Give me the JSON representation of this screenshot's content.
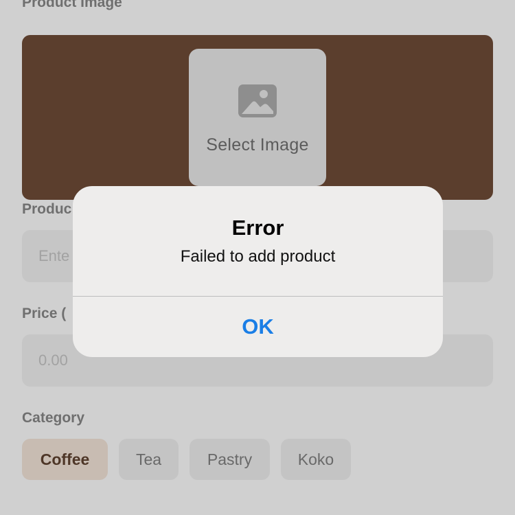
{
  "form": {
    "image_section_label": "Product Image",
    "select_image_label": "Select Image",
    "photo_icon": "photo-icon",
    "name_label": "Produc",
    "name_placeholder": "Ente",
    "price_label": "Price (",
    "price_placeholder": "0.00",
    "category_label": "Category",
    "categories": [
      {
        "label": "Coffee",
        "selected": true
      },
      {
        "label": "Tea",
        "selected": false
      },
      {
        "label": "Pastry",
        "selected": false
      },
      {
        "label": "Koko",
        "selected": false
      }
    ]
  },
  "alert": {
    "title": "Error",
    "message": "Failed to add product",
    "ok_label": "OK"
  },
  "colors": {
    "image_panel": "#5b3e2d",
    "accent": "#1a7ee6",
    "selected_chip_text": "#4e3627"
  }
}
